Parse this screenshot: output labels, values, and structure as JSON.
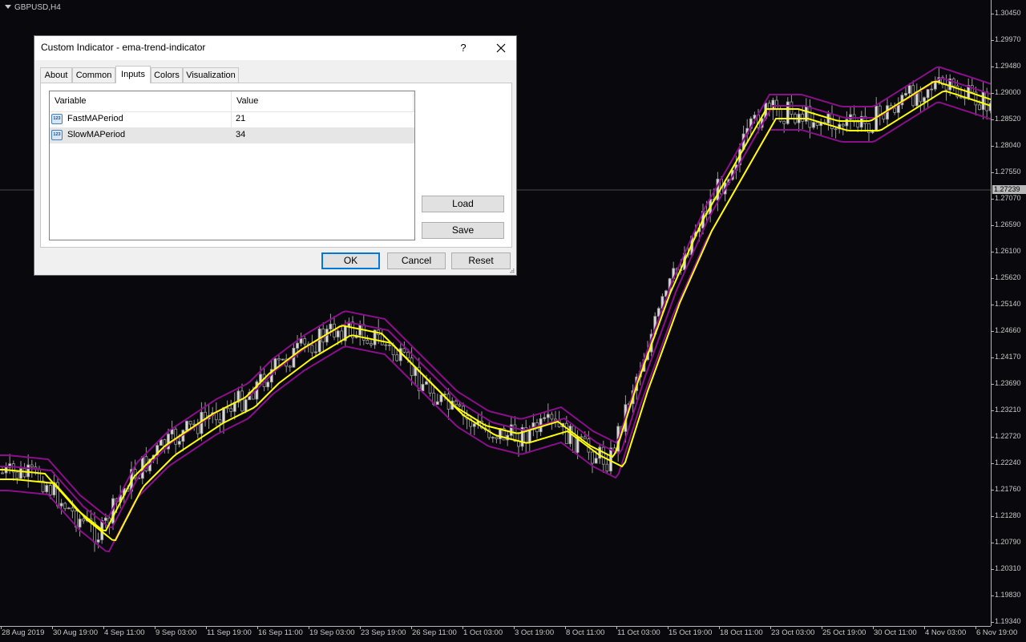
{
  "chart": {
    "symbol": "GBPUSD,H4",
    "current_price": "1.27239",
    "price_ticks": [
      "1.30450",
      "1.29970",
      "1.29480",
      "1.29000",
      "1.28520",
      "1.28040",
      "1.27550",
      "1.27070",
      "1.26590",
      "1.26100",
      "1.25620",
      "1.25140",
      "1.24660",
      "1.24170",
      "1.23690",
      "1.23210",
      "1.22720",
      "1.22240",
      "1.21760",
      "1.21280",
      "1.20790",
      "1.20310",
      "1.19830",
      "1.19340"
    ],
    "time_ticks": [
      "28 Aug 2019",
      "30 Aug 19:00",
      "4 Sep 11:00",
      "9 Sep 03:00",
      "11 Sep 19:00",
      "16 Sep 11:00",
      "19 Sep 03:00",
      "23 Sep 19:00",
      "26 Sep 11:00",
      "1 Oct 03:00",
      "3 Oct 19:00",
      "8 Oct 11:00",
      "11 Oct 03:00",
      "15 Oct 19:00",
      "18 Oct 11:00",
      "23 Oct 03:00",
      "25 Oct 19:00",
      "30 Oct 11:00",
      "4 Nov 03:00",
      "6 Nov 19:00"
    ],
    "colors": {
      "background": "#09090d",
      "candles": "#9a9a9a",
      "ema_fast": "#ffff00",
      "ema_bands": "#8b0f8b",
      "axis_text": "#c8c8c8"
    }
  },
  "dialog": {
    "title": "Custom Indicator - ema-trend-indicator",
    "help_label": "?",
    "tabs": [
      "About",
      "Common",
      "Inputs",
      "Colors",
      "Visualization"
    ],
    "active_tab": "Inputs",
    "grid": {
      "headers": [
        "Variable",
        "Value"
      ],
      "rows": [
        {
          "icon": "123",
          "variable": "FastMAPeriod",
          "value": "21"
        },
        {
          "icon": "123",
          "variable": "SlowMAPeriod",
          "value": "34"
        }
      ]
    },
    "side_buttons": {
      "load": "Load",
      "save": "Save"
    },
    "footer_buttons": {
      "ok": "OK",
      "cancel": "Cancel",
      "reset": "Reset"
    }
  }
}
